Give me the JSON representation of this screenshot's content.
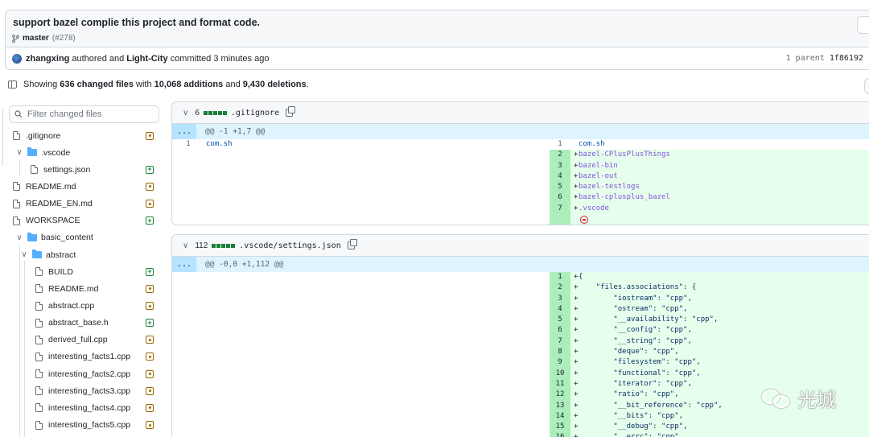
{
  "commit": {
    "title": "support bazel complie this project and format code.",
    "branch": "master",
    "pr_ref": "(#278)",
    "author": "zhangxing",
    "authored_text": "authored and",
    "committer": "Light-City",
    "committed_text": "committed 3 minutes ago",
    "parent_label": "1 parent",
    "parent_sha": "1f86192"
  },
  "summary": {
    "prefix": "Showing",
    "files": "636 changed files",
    "with": "with",
    "additions": "10,068 additions",
    "and": "and",
    "deletions": "9,430 deletions",
    "end": "."
  },
  "filter": {
    "placeholder": "Filter changed files"
  },
  "tree": [
    {
      "label": ".gitignore",
      "type": "file",
      "status": "modified"
    },
    {
      "label": ".vscode",
      "type": "folder",
      "expanded": true
    },
    {
      "label": "settings.json",
      "type": "file",
      "status": "added"
    },
    {
      "label": "README.md",
      "type": "file",
      "status": "modified"
    },
    {
      "label": "README_EN.md",
      "type": "file",
      "status": "modified"
    },
    {
      "label": "WORKSPACE",
      "type": "file",
      "status": "added"
    },
    {
      "label": "basic_content",
      "type": "folder",
      "expanded": true
    },
    {
      "label": "abstract",
      "type": "folder",
      "expanded": true
    },
    {
      "label": "BUILD",
      "type": "file",
      "status": "added"
    },
    {
      "label": "README.md",
      "type": "file",
      "status": "modified"
    },
    {
      "label": "abstract.cpp",
      "type": "file",
      "status": "modified"
    },
    {
      "label": "abstract_base.h",
      "type": "file",
      "status": "added"
    },
    {
      "label": "derived_full.cpp",
      "type": "file",
      "status": "modified"
    },
    {
      "label": "interesting_facts1.cpp",
      "type": "file",
      "status": "modified"
    },
    {
      "label": "interesting_facts2.cpp",
      "type": "file",
      "status": "modified"
    },
    {
      "label": "interesting_facts3.cpp",
      "type": "file",
      "status": "modified"
    },
    {
      "label": "interesting_facts4.cpp",
      "type": "file",
      "status": "modified"
    },
    {
      "label": "interesting_facts5.cpp",
      "type": "file",
      "status": "modified"
    }
  ],
  "diffs": [
    {
      "count": "6",
      "filename": ".gitignore",
      "hunk": "@@ -1 +1,7 @@",
      "expand": "...",
      "left": [
        {
          "num": "1",
          "code": "com.sh"
        }
      ],
      "right": [
        {
          "num": "1",
          "sign": "",
          "code": "com.sh",
          "ctx": true
        },
        {
          "num": "2",
          "sign": "+",
          "code": "bazel-CPlusPlusThings"
        },
        {
          "num": "3",
          "sign": "+",
          "code": "bazel-bin"
        },
        {
          "num": "4",
          "sign": "+",
          "code": "bazel-out"
        },
        {
          "num": "5",
          "sign": "+",
          "code": "bazel-testlogs"
        },
        {
          "num": "6",
          "sign": "+",
          "code": "bazel-cplusplus_bazel"
        },
        {
          "num": "7",
          "sign": "+",
          "code": ".vscode"
        }
      ]
    },
    {
      "count": "112",
      "filename": ".vscode/settings.json",
      "hunk": "@@ -0,0 +1,112 @@",
      "expand": "...",
      "right": [
        {
          "num": "1",
          "sign": "+",
          "code": "{"
        },
        {
          "num": "2",
          "sign": "+",
          "code": "    \"files.associations\": {"
        },
        {
          "num": "3",
          "sign": "+",
          "code": "        \"iostream\": \"cpp\","
        },
        {
          "num": "4",
          "sign": "+",
          "code": "        \"ostream\": \"cpp\","
        },
        {
          "num": "5",
          "sign": "+",
          "code": "        \"__availability\": \"cpp\","
        },
        {
          "num": "6",
          "sign": "+",
          "code": "        \"__config\": \"cpp\","
        },
        {
          "num": "7",
          "sign": "+",
          "code": "        \"__string\": \"cpp\","
        },
        {
          "num": "8",
          "sign": "+",
          "code": "        \"deque\": \"cpp\","
        },
        {
          "num": "9",
          "sign": "+",
          "code": "        \"filesystem\": \"cpp\","
        },
        {
          "num": "10",
          "sign": "+",
          "code": "        \"functional\": \"cpp\","
        },
        {
          "num": "11",
          "sign": "+",
          "code": "        \"iterator\": \"cpp\","
        },
        {
          "num": "12",
          "sign": "+",
          "code": "        \"ratio\": \"cpp\","
        },
        {
          "num": "13",
          "sign": "+",
          "code": "        \"__bit_reference\": \"cpp\","
        },
        {
          "num": "14",
          "sign": "+",
          "code": "        \"__bits\": \"cpp\","
        },
        {
          "num": "15",
          "sign": "+",
          "code": "        \"__debug\": \"cpp\","
        },
        {
          "num": "16",
          "sign": "+",
          "code": "        \"__errc\": \"cpp\","
        }
      ]
    }
  ],
  "watermark": {
    "text": "光城"
  },
  "colors": {
    "added": "#1a7f37",
    "modified": "#9a6700",
    "add_row": "#e6ffec",
    "add_num": "#aceebb",
    "hunk": "#ddf4ff"
  }
}
